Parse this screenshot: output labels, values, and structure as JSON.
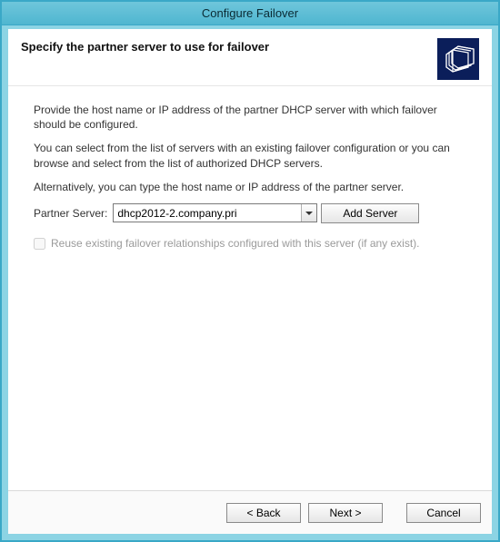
{
  "window": {
    "title": "Configure Failover"
  },
  "header": {
    "title": "Specify the partner server to use for failover",
    "icon": "folder-stack-icon"
  },
  "content": {
    "para1": "Provide the host name or IP address of the partner DHCP server with which failover should be configured.",
    "para2": "You can select from the list of servers with an existing failover configuration or you can browse and select from the list of authorized DHCP servers.",
    "para3": "Alternatively, you can type the host name or IP address of the partner server."
  },
  "form": {
    "partner_label": "Partner Server:",
    "partner_value": "dhcp2012-2.company.pri",
    "add_server_label": "Add Server"
  },
  "checkbox": {
    "reuse_label": "Reuse existing failover relationships configured with this server (if any exist).",
    "checked": false,
    "disabled": true
  },
  "footer": {
    "back_label": "< Back",
    "next_label": "Next >",
    "cancel_label": "Cancel"
  },
  "colors": {
    "titlebar": "#4fb6d0",
    "border": "#8cd4e4",
    "icon_bg": "#0b1e5a"
  }
}
